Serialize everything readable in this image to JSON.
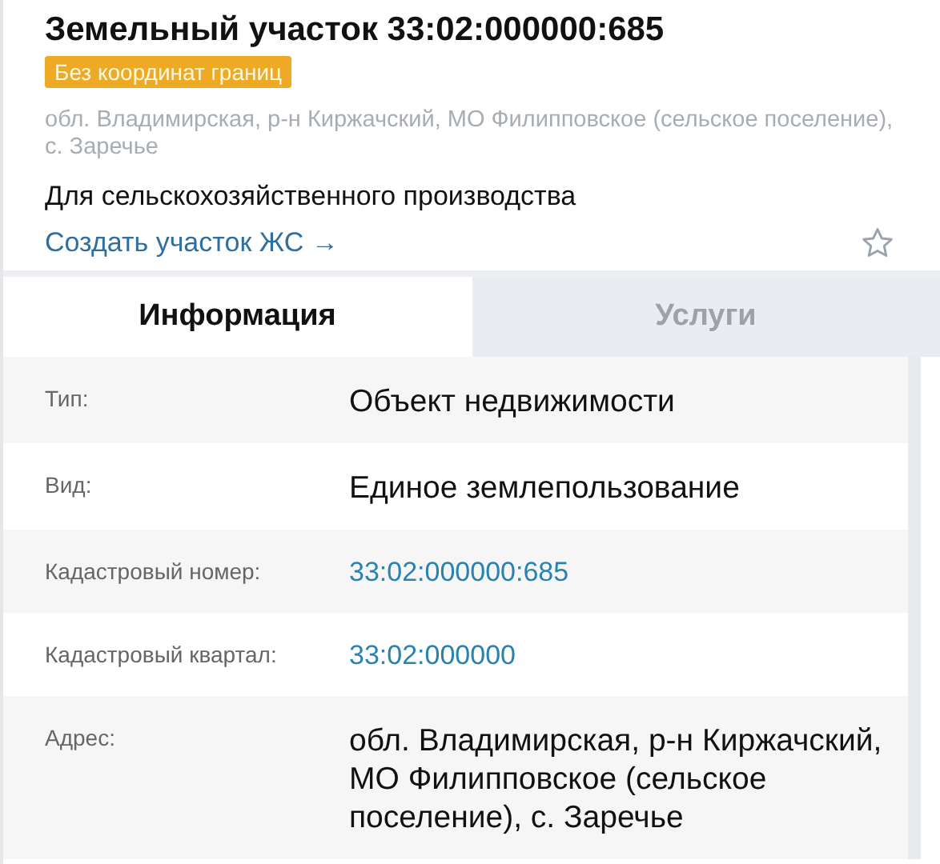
{
  "title": "Земельный участок 33:02:000000:685",
  "badge": "Без координат границ",
  "address": "обл. Владимирская, р-н Киржачский, МО Филипповское (сельское поселение), с. Заречье",
  "purpose": "Для сельскохозяйственного производства",
  "create_link": "Создать участок ЖС →",
  "favorite": {
    "on": false
  },
  "tabs": [
    {
      "label": "Информация",
      "selected": true
    },
    {
      "label": "Услуги",
      "selected": false
    }
  ],
  "rows": [
    {
      "label": "Тип:",
      "value": "Объект недвижимости",
      "kind": "text"
    },
    {
      "label": "Вид:",
      "value": "Единое землепользование",
      "kind": "text"
    },
    {
      "label": "Кадастровый номер:",
      "value": "33:02:000000:685",
      "kind": "link"
    },
    {
      "label": "Кадастровый квартал:",
      "value": "33:02:000000",
      "kind": "link"
    },
    {
      "label": "Адрес:",
      "value": "обл. Владимирская, р-н Киржачский, МО Филипповское (сельское поселение), с. Заречье",
      "kind": "text"
    }
  ]
}
